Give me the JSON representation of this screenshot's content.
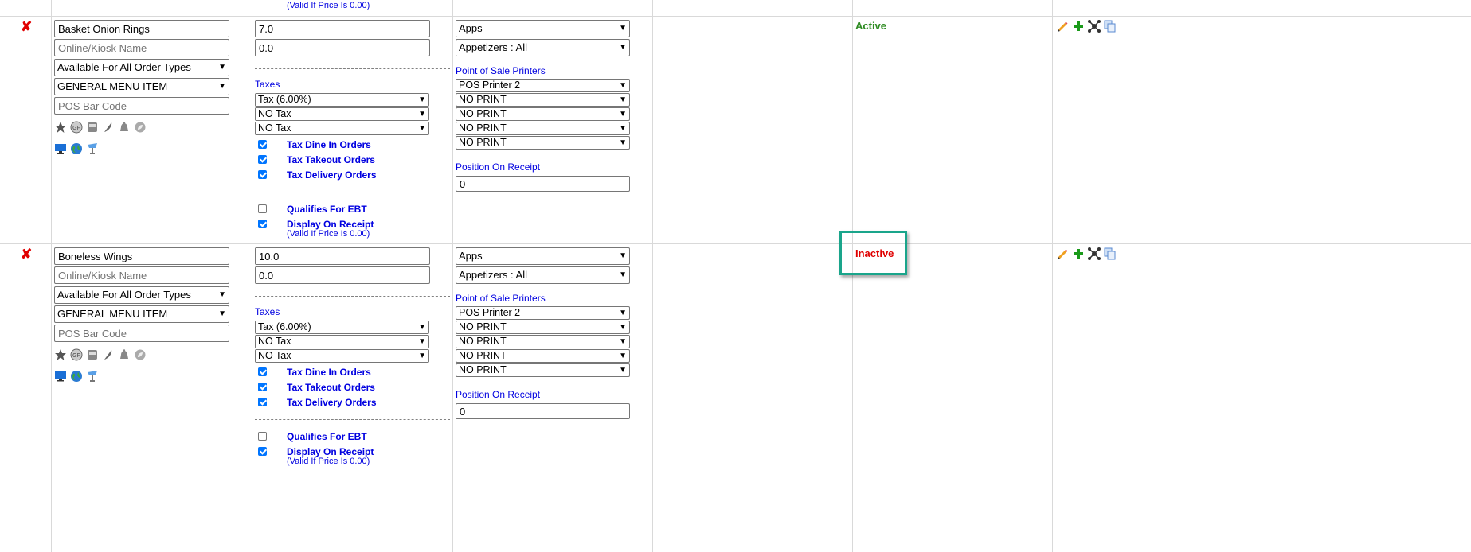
{
  "top_note": "(Valid If Price Is 0.00)",
  "rows": [
    {
      "delete_icon": "✘",
      "name": "Basket Onion Rings",
      "kiosk_placeholder": "Online/Kiosk Name",
      "order_types": "Available For All Order Types",
      "item_type": "GENERAL MENU ITEM",
      "barcode_placeholder": "POS Bar Code",
      "price": "7.0",
      "price2": "0.0",
      "taxes_label": "Taxes",
      "tax1": "Tax (6.00%)",
      "tax2": "NO Tax",
      "tax3": "NO Tax",
      "tax_dine_in": "Tax Dine In Orders",
      "tax_takeout": "Tax Takeout Orders",
      "tax_delivery": "Tax Delivery Orders",
      "qualifies_ebt": "Qualifies For EBT",
      "display_receipt": "Display On Receipt",
      "valid_note": "(Valid If Price Is 0.00)",
      "category": "Apps",
      "subcategory": "Appetizers : All",
      "printers_label": "Point of Sale Printers",
      "printer1": "POS Printer 2",
      "printer2": "NO PRINT",
      "printer3": "NO PRINT",
      "printer4": "NO PRINT",
      "printer5": "NO PRINT",
      "position_label": "Position On Receipt",
      "position": "0",
      "status": "Active"
    },
    {
      "delete_icon": "✘",
      "name": "Boneless Wings",
      "kiosk_placeholder": "Online/Kiosk Name",
      "order_types": "Available For All Order Types",
      "item_type": "GENERAL MENU ITEM",
      "barcode_placeholder": "POS Bar Code",
      "price": "10.0",
      "price2": "0.0",
      "taxes_label": "Taxes",
      "tax1": "Tax (6.00%)",
      "tax2": "NO Tax",
      "tax3": "NO Tax",
      "tax_dine_in": "Tax Dine In Orders",
      "tax_takeout": "Tax Takeout Orders",
      "tax_delivery": "Tax Delivery Orders",
      "qualifies_ebt": "Qualifies For EBT",
      "display_receipt": "Display On Receipt",
      "valid_note": "(Valid If Price Is 0.00)",
      "category": "Apps",
      "subcategory": "Appetizers : All",
      "printers_label": "Point of Sale Printers",
      "printer1": "POS Printer 2",
      "printer2": "NO PRINT",
      "printer3": "NO PRINT",
      "printer4": "NO PRINT",
      "printer5": "NO PRINT",
      "position_label": "Position On Receipt",
      "position": "0",
      "status": "Inactive"
    }
  ],
  "colors": {
    "highlight": "#1aa58b",
    "active": "#2e8b22",
    "inactive": "#e00000",
    "label_blue": "#0000e0"
  }
}
